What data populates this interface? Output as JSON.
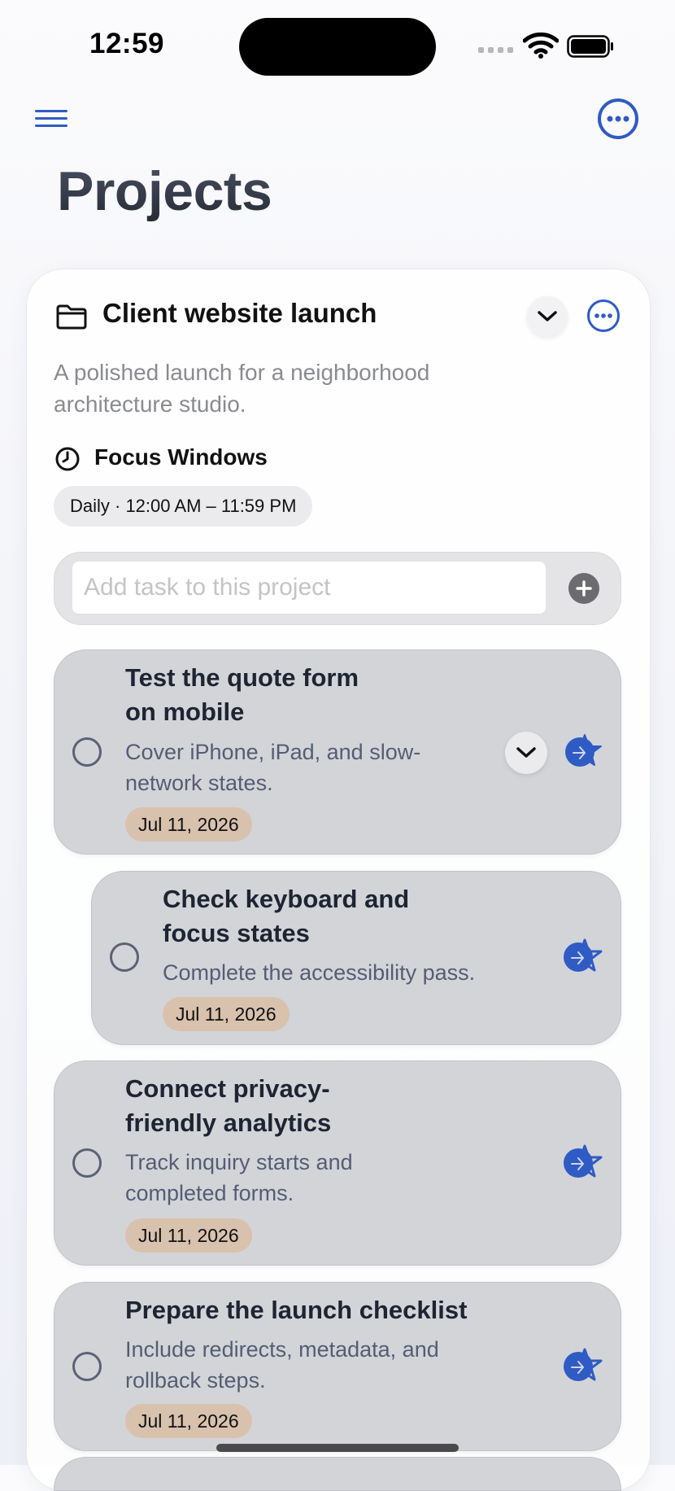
{
  "status_bar": {
    "time": "12:59"
  },
  "header": {
    "title": "Projects",
    "menu_icon": "hamburger-icon",
    "more_icon": "ellipsis-circle-icon"
  },
  "project": {
    "name": "Client website launch",
    "description": "A polished launch for a neighborhood architecture studio.",
    "focus_heading": "Focus Windows",
    "focus_window": "Daily · 12:00 AM – 11:59 PM",
    "add_task_placeholder": "Add task to this project",
    "accent_color": "#2f5bc4"
  },
  "tasks": [
    {
      "title": "Test the quote form on mobile",
      "note": "Cover iPhone, iPad, and slow-network states.",
      "date": "Jul 11, 2026"
    },
    {
      "title": "Check keyboard and focus states",
      "note": "Complete the accessibility pass.",
      "date": "Jul 11, 2026"
    },
    {
      "title": "Connect privacy-friendly analytics",
      "note": "Track inquiry starts and completed forms.",
      "date": "Jul 11, 2026"
    },
    {
      "title": "Prepare the launch checklist",
      "note": "Include redirects, metadata, and rollback steps.",
      "date": "Jul 11, 2026"
    }
  ]
}
